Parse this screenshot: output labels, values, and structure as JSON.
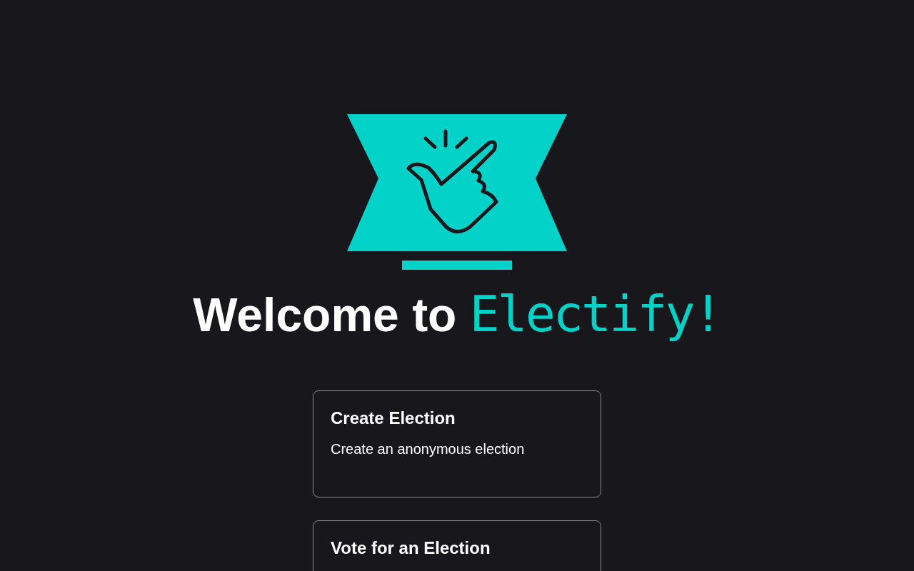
{
  "heading": {
    "text": "Welcome to",
    "brand": "Electify!"
  },
  "cards": [
    {
      "title": "Create Election",
      "description": "Create an anonymous election"
    },
    {
      "title": "Vote for an Election"
    }
  ]
}
